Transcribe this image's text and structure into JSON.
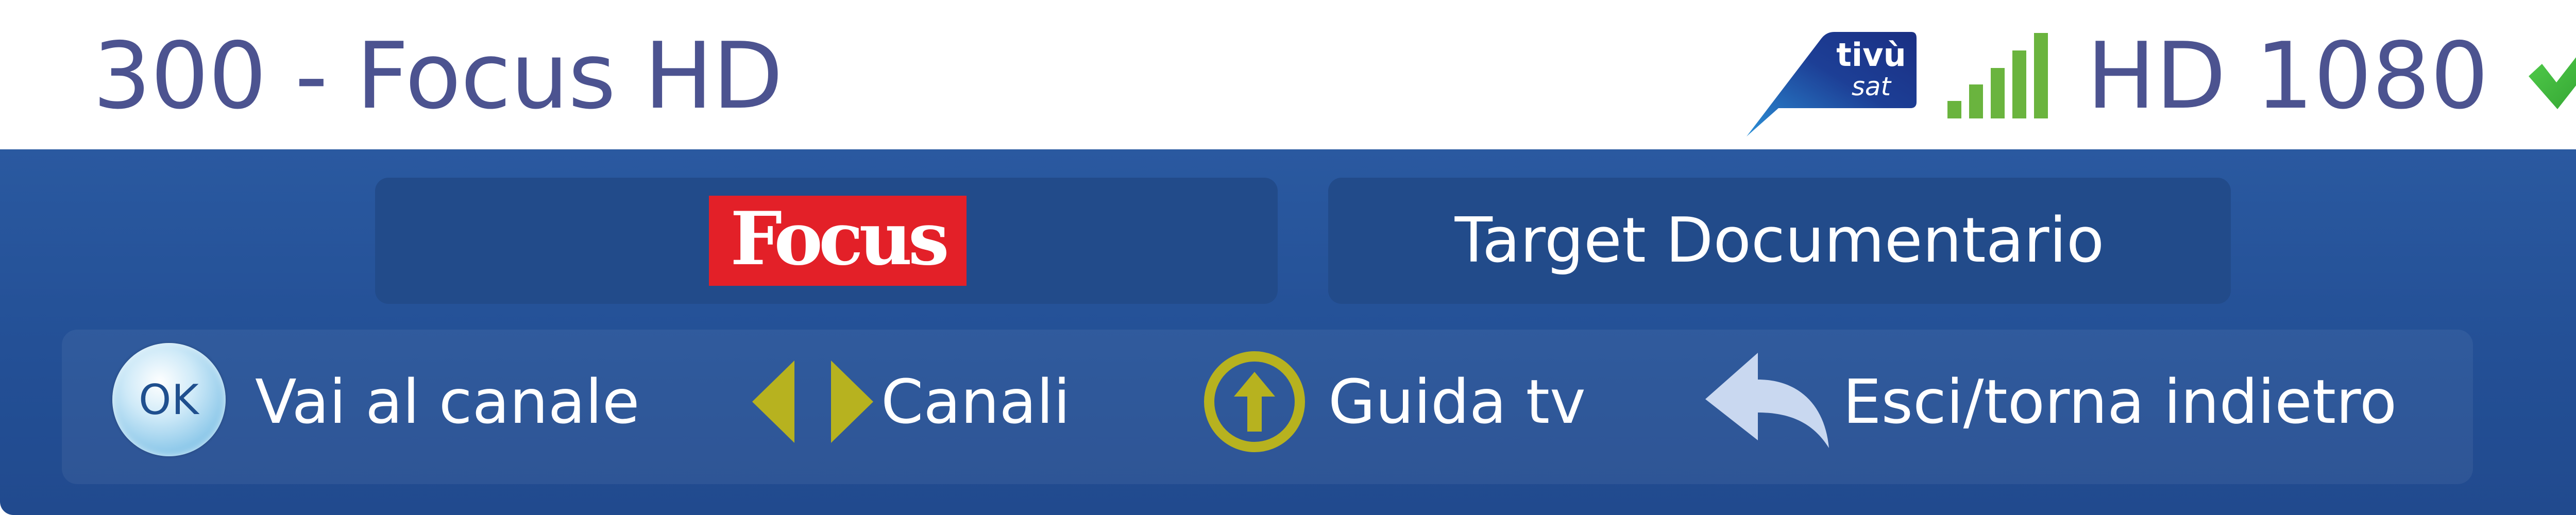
{
  "header": {
    "channel_title": "300 - Focus HD",
    "tivusat_logo": {
      "line1": "tivù",
      "line2": "sat"
    },
    "signal_level": 1.0,
    "resolution": "HD 1080",
    "status_icon": "check-icon"
  },
  "info": {
    "channel_logo_text": "Focus",
    "genre": "Target Documentario"
  },
  "controls": {
    "ok": {
      "key": "OK",
      "label": "Vai al canale"
    },
    "channels": {
      "icon": "left-right-arrows-icon",
      "label": "Canali"
    },
    "guide": {
      "icon": "up-arrow-circle-icon",
      "label": "Guida tv"
    },
    "back": {
      "icon": "back-arrow-icon",
      "label": "Esci/torna indietro"
    }
  },
  "colors": {
    "title_text": "#4c5390",
    "bar_background": "#2a59a0",
    "pill_background": "#224b8a",
    "focus_red": "#e32028",
    "signal_green": "#6ab43e",
    "check_green": "#3fbf3f",
    "arrows_yellow": "#b7b21f",
    "back_arrow": "#c9d8f0"
  }
}
